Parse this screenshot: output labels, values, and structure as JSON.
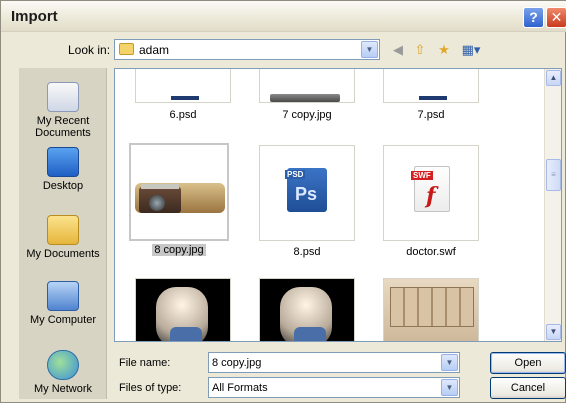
{
  "window": {
    "title": "Import",
    "help_label": "?",
    "close_label": "✕"
  },
  "lookin": {
    "label": "Look in:",
    "value": "adam"
  },
  "places": [
    {
      "label": "My Recent Documents"
    },
    {
      "label": "Desktop"
    },
    {
      "label": "My Documents"
    },
    {
      "label": "My Computer"
    },
    {
      "label": "My Network"
    }
  ],
  "files": [
    {
      "name": "6.psd"
    },
    {
      "name": "7 copy.jpg"
    },
    {
      "name": "7.psd"
    },
    {
      "name": "8 copy.jpg",
      "selected": true
    },
    {
      "name": "8.psd"
    },
    {
      "name": "doctor.swf"
    },
    {
      "name": ""
    },
    {
      "name": ""
    },
    {
      "name": ""
    }
  ],
  "psd_badge": {
    "tag": "PSD",
    "mark": "Ps"
  },
  "swf_badge": {
    "tag": "SWF",
    "mark": "f"
  },
  "filename": {
    "label": "File name:",
    "value": "8 copy.jpg"
  },
  "filetype": {
    "label": "Files of type:",
    "value": "All Formats"
  },
  "buttons": {
    "open": "Open",
    "cancel": "Cancel"
  },
  "colors": {
    "selection": "#c7c7c7",
    "xp_blue_border": "#7f9db9",
    "dialog_bg": "#ece9d8"
  }
}
